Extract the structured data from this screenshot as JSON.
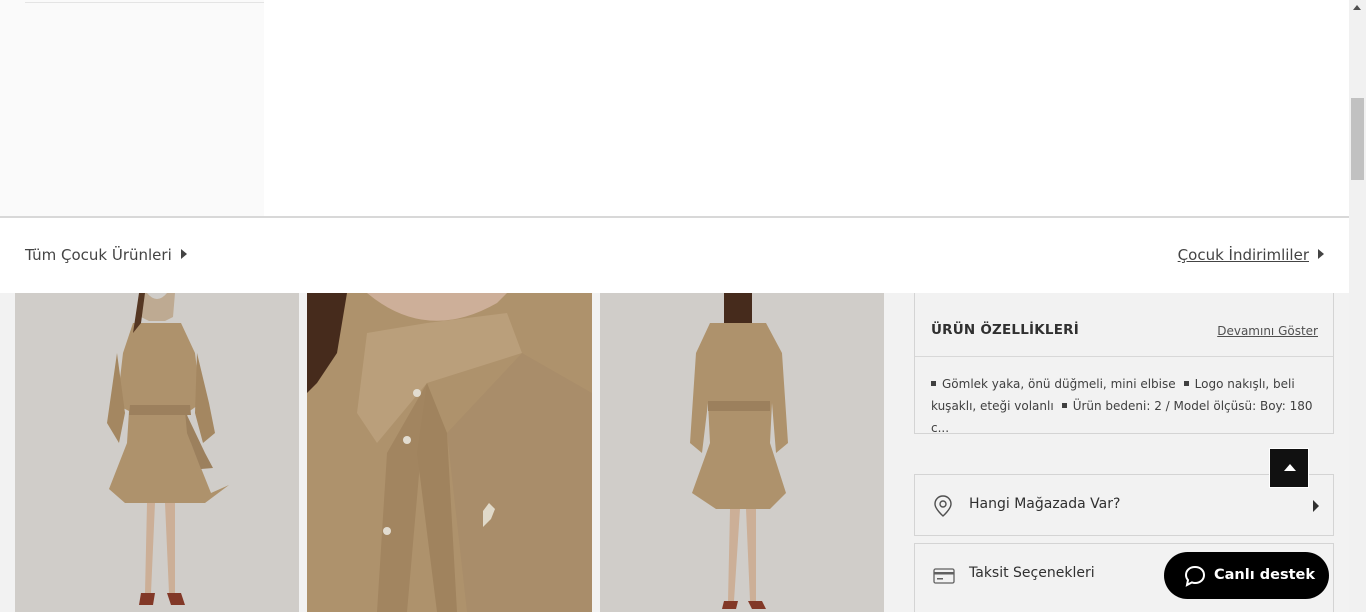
{
  "menu": {
    "all_kids_link": "Tüm Çocuk Ürünleri",
    "kids_sale_link": "Çocuk İndirimliler"
  },
  "product": {
    "images": [
      {
        "alt": "Bej gömlek elbise ön görünüm"
      },
      {
        "alt": "Gömlek yaka detay"
      },
      {
        "alt": "Bej gömlek elbise arka görünüm"
      }
    ],
    "features": {
      "title": "ÜRÜN ÖZELLİKLERİ",
      "more_label": "Devamını Göster",
      "item1": "Gömlek yaka, önü düğmeli, mini elbise",
      "item2a": "Logo nakışlı, beli",
      "item2b": "kuşaklı, eteği volanlı",
      "item3": "Ürün bedeni: 2 / Model ölçüsü: Boy: 180 c..."
    },
    "store_row": {
      "label": "Hangi Mağazada Var?",
      "icon": "location-pin-icon"
    },
    "installment_row": {
      "label": "Taksit Seçenekleri",
      "icon": "credit-card-icon"
    }
  },
  "chat": {
    "label": "Canlı destek",
    "icon": "chat-bubble-icon"
  },
  "colors": {
    "garment": "#b89a72",
    "overlay_dark": "rgba(0,0,0,0.05)"
  }
}
